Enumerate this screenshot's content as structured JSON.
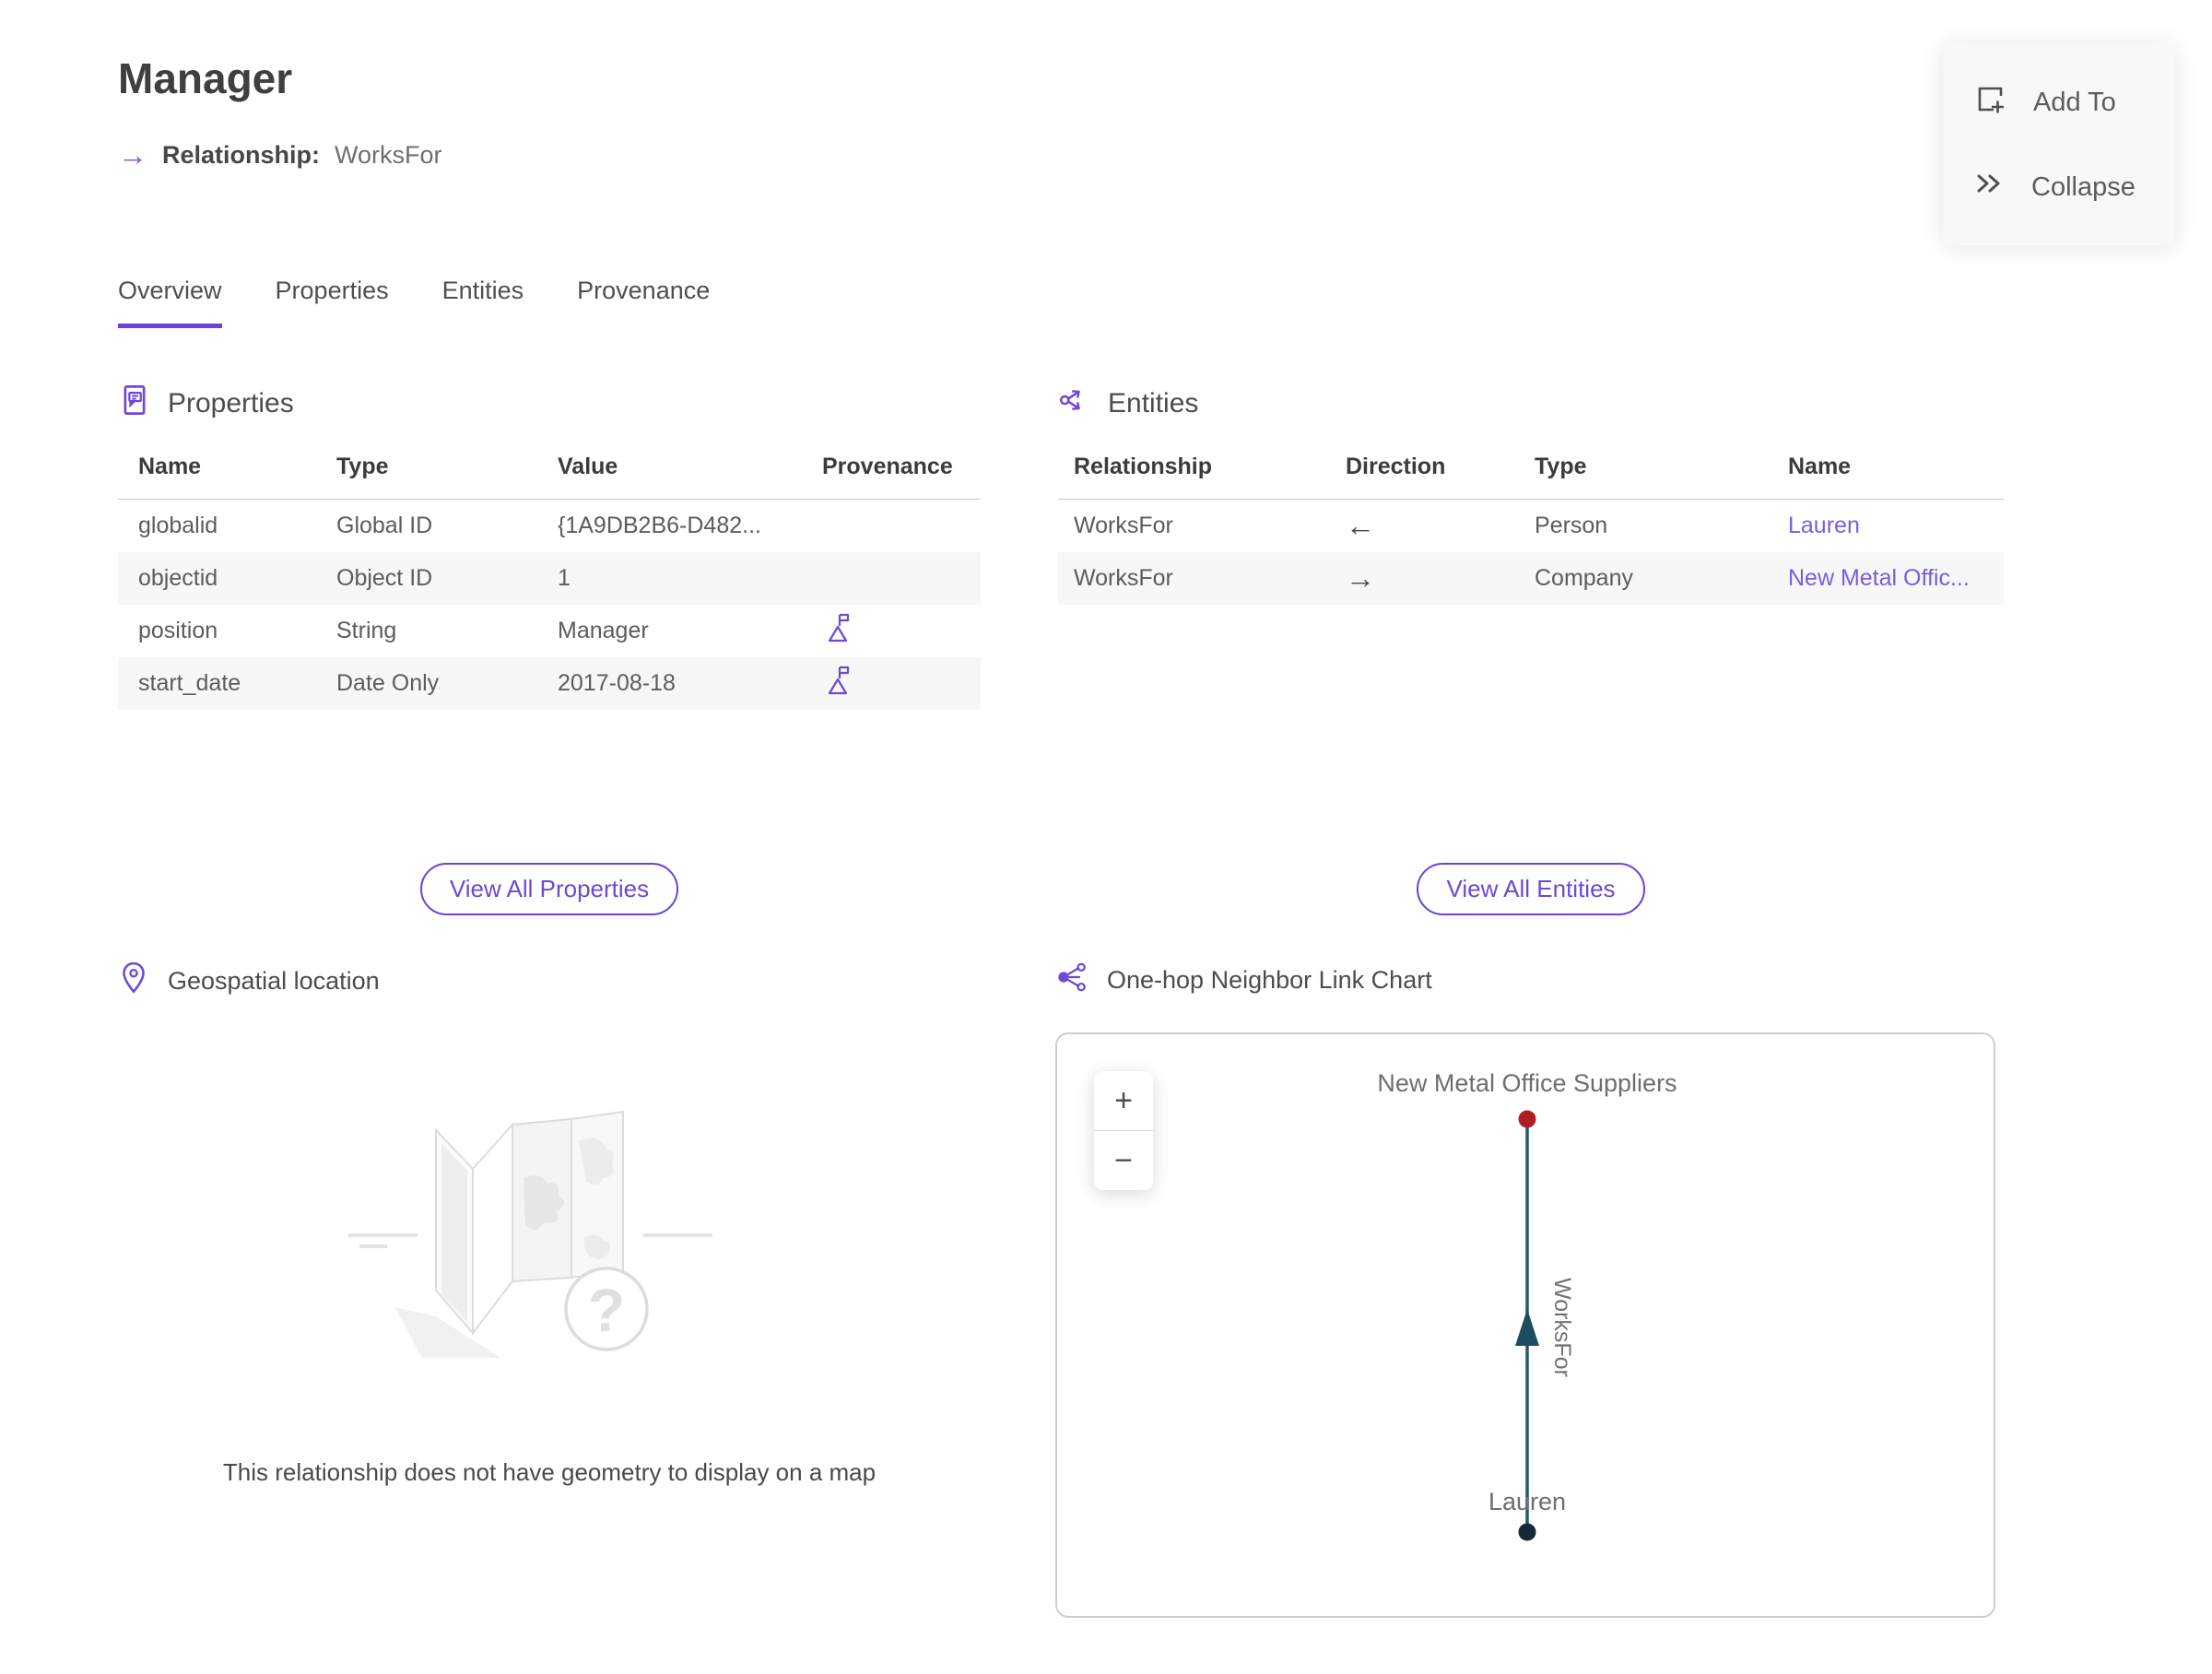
{
  "header": {
    "title": "Manager",
    "arrow_icon": "→",
    "subtitle_label": "Relationship:",
    "subtitle_value": "WorksFor"
  },
  "actions": {
    "add_to_label": "Add To",
    "collapse_label": "Collapse"
  },
  "tabs": [
    {
      "label": "Overview",
      "active": true
    },
    {
      "label": "Properties",
      "active": false
    },
    {
      "label": "Entities",
      "active": false
    },
    {
      "label": "Provenance",
      "active": false
    }
  ],
  "properties_section": {
    "title": "Properties",
    "columns": [
      "Name",
      "Type",
      "Value",
      "Provenance"
    ],
    "rows": [
      {
        "name": "globalid",
        "type": "Global ID",
        "value": "{1A9DB2B6-D482...",
        "provenance": false
      },
      {
        "name": "objectid",
        "type": "Object ID",
        "value": "1",
        "provenance": false
      },
      {
        "name": "position",
        "type": "String",
        "value": "Manager",
        "provenance": true
      },
      {
        "name": "start_date",
        "type": "Date Only",
        "value": "2017-08-18",
        "provenance": true
      }
    ],
    "view_all_label": "View All Properties"
  },
  "entities_section": {
    "title": "Entities",
    "columns": [
      "Relationship",
      "Direction",
      "Type",
      "Name"
    ],
    "rows": [
      {
        "relationship": "WorksFor",
        "direction": "←",
        "type": "Person",
        "name": "Lauren"
      },
      {
        "relationship": "WorksFor",
        "direction": "→",
        "type": "Company",
        "name": "New Metal Offic..."
      }
    ],
    "view_all_label": "View All Entities"
  },
  "geospatial_section": {
    "title": "Geospatial location",
    "empty_message": "This relationship does not have geometry to display on a map"
  },
  "link_chart_section": {
    "title": "One-hop Neighbor Link Chart",
    "zoom_in": "+",
    "zoom_out": "−",
    "top_node_label": "New Metal Office Suppliers",
    "bottom_node_label": "Lauren",
    "edge_label": "WorksFor"
  },
  "colors": {
    "accent_purple": "#6a43d8",
    "link_purple": "#7a5de0",
    "top_node_red": "#ae1f24",
    "bottom_node_navy": "#15293b",
    "edge_teal": "#27586a",
    "label_gray": "#6e6e6e",
    "stripe_gray": "#f7f7f7"
  }
}
